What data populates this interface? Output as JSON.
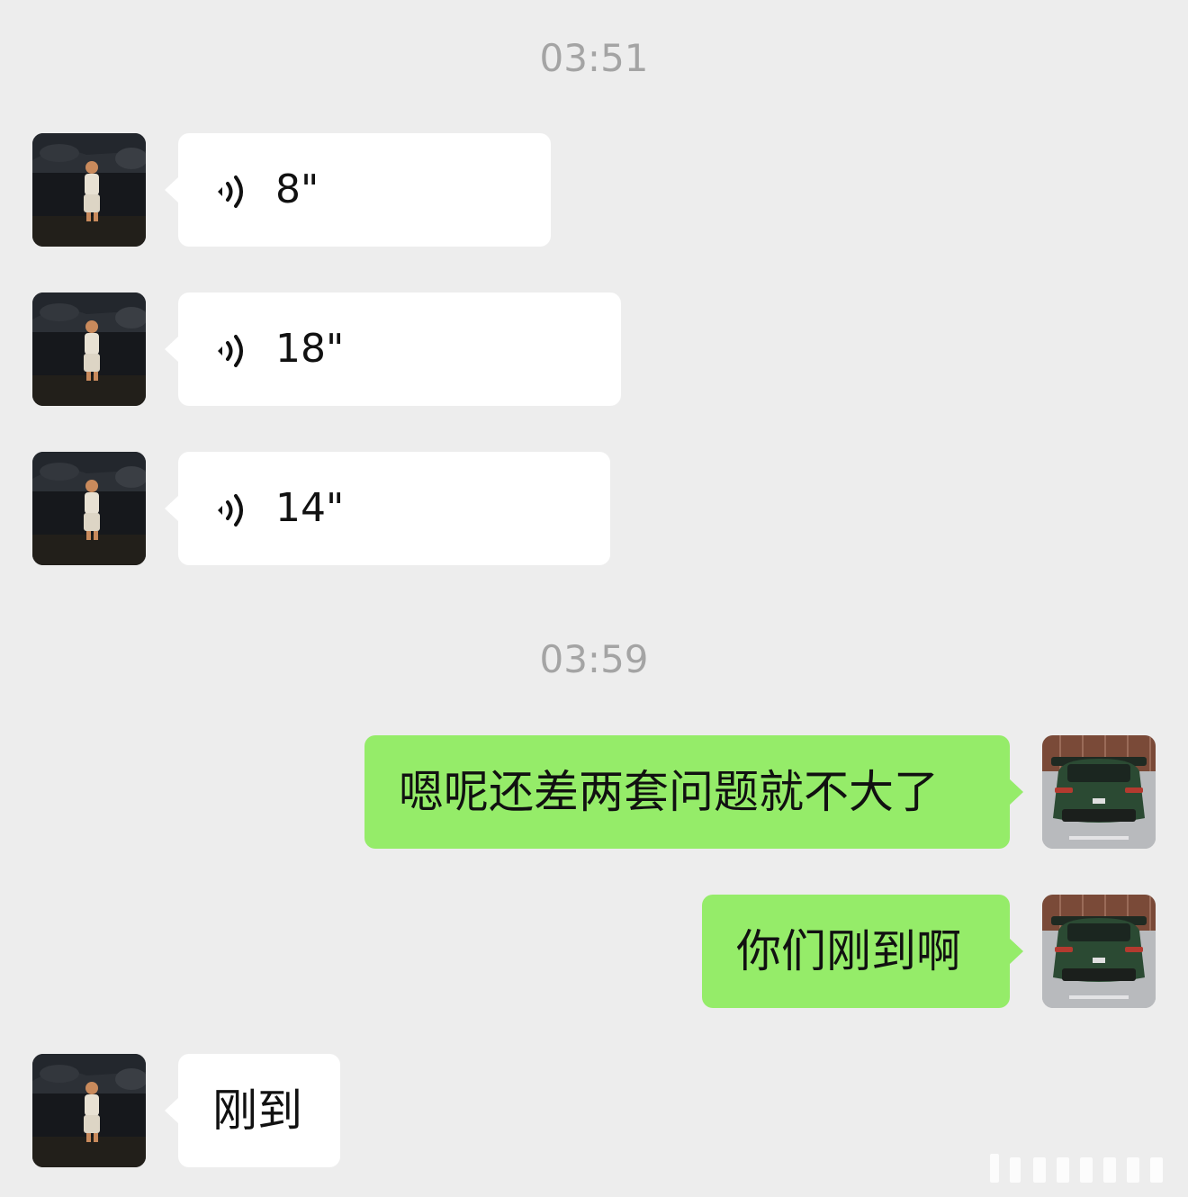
{
  "timestamps": [
    "03:51",
    "03:59"
  ],
  "messages": [
    {
      "sender": "contact",
      "type": "voice",
      "duration": "8\""
    },
    {
      "sender": "contact",
      "type": "voice",
      "duration": "18\""
    },
    {
      "sender": "contact",
      "type": "voice",
      "duration": "14\""
    },
    {
      "sender": "self",
      "type": "text",
      "text": "嗯呢还差两套问题就不大了"
    },
    {
      "sender": "self",
      "type": "text",
      "text": "你们刚到啊"
    },
    {
      "sender": "contact",
      "type": "text",
      "text": "刚到"
    }
  ],
  "icons": {
    "voice": "voice-wave-icon",
    "contact_avatar": "child-photo-avatar",
    "self_avatar": "green-car-photo-avatar"
  },
  "colors": {
    "background": "#ededed",
    "incoming_bubble": "#ffffff",
    "outgoing_bubble": "#95ec69",
    "timestamp": "#a4a4a4"
  }
}
